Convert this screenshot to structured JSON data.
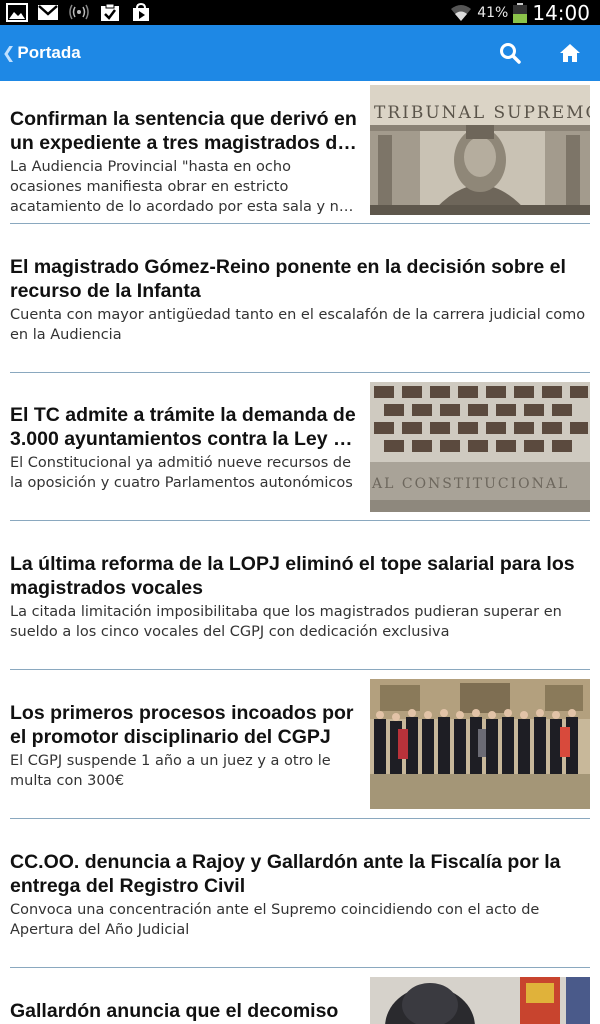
{
  "status_bar": {
    "battery_percent": "41%",
    "time": "14:00",
    "notification_icons": [
      "gallery-icon",
      "gmail-icon",
      "radio-signal-icon",
      "task-check-icon",
      "play-store-icon"
    ]
  },
  "action_bar": {
    "back_label": "Portada",
    "color": "#1e88e5",
    "icons": [
      "search-icon",
      "home-icon"
    ]
  },
  "articles": [
    {
      "title": "Confirman la sentencia que derivó en un expediente a tres magistrados de la Audiencia Provincial de Madrid",
      "summary": "La Audiencia Provincial \"hasta en ocho ocasiones manifiesta obrar en estricto acatamiento de lo acordado por esta sala y no cumple lo ordenado\"",
      "image": "tribunal-supremo-facade"
    },
    {
      "title": "El magistrado Gómez-Reino ponente en la decisión sobre el recurso de la Infanta",
      "summary": "Cuenta con mayor antigüedad tanto en el escalafón de la carrera judicial como en la Audiencia",
      "image": ""
    },
    {
      "title": "El TC admite a trámite la demanda de 3.000 ayuntamientos contra la Ley de Reforma Local",
      "summary": "El Constitucional ya admitió nueve recursos de la oposición y cuatro Parlamentos autonómicos",
      "image": "tribunal-constitucional-building"
    },
    {
      "title": "La última reforma de la LOPJ eliminó el tope salarial para los magistrados vocales",
      "summary": "La citada limitación imposibilitaba que los magistrados pudieran superar en sueldo a los cinco vocales del CGPJ con dedicación exclusiva",
      "image": ""
    },
    {
      "title": "Los primeros procesos incoados por el promotor disciplinario del CGPJ",
      "summary": "El CGPJ suspende 1 año a un juez y a otro le multa con 300€",
      "image": "cgpj-group-photo"
    },
    {
      "title": "CC.OO. denuncia a Rajoy y Gallardón ante la Fiscalía por la entrega del Registro Civil",
      "summary": "Convoca una concentración ante el Supremo coincidiendo con el acto de Apertura del Año Judicial",
      "image": ""
    },
    {
      "title": "Gallardón anuncia que el decomiso",
      "summary": "",
      "image": "gallardon-portrait"
    }
  ]
}
